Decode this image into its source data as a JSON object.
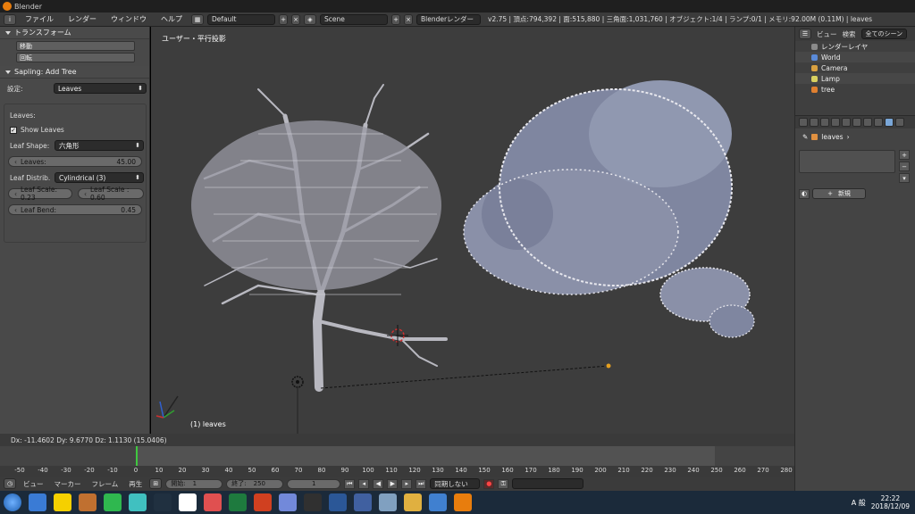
{
  "window": {
    "title": "Blender"
  },
  "menu": {
    "items": [
      "ファイル",
      "レンダー",
      "ウィンドウ",
      "ヘルプ"
    ],
    "layout": "Default",
    "scene": "Scene",
    "engine": "Blenderレンダー",
    "stats": "v2.75 | 頂点:794,392 | 面:515,880 | 三角面:1,031,760 | オブジェクト:1/4 | ランプ:0/1 | メモリ:92.00M (0.11M) | leaves"
  },
  "left_panel": {
    "transform_header": "トランスフォーム",
    "transform_buttons": [
      "移動",
      "回転"
    ],
    "sapling_header": "Sapling: Add Tree",
    "settings_label": "設定:",
    "settings_value": "Leaves",
    "leaves_title": "Leaves:",
    "show_leaves_label": "Show Leaves",
    "show_leaves_checked": true,
    "leaf_shape_label": "Leaf Shape:",
    "leaf_shape_value": "六角形",
    "leaves_field": {
      "label": "Leaves:",
      "value": "45.00"
    },
    "leaf_distrib_label": "Leaf Distrib.",
    "leaf_distrib_value": "Cylindrical (3)",
    "leaf_scale": {
      "label": "Leaf Scale: 0.23"
    },
    "leaf_scale_x": {
      "label": "Leaf Scale : 0.60"
    },
    "leaf_bend": {
      "label": "Leaf Bend:",
      "value": "0.45"
    }
  },
  "viewport": {
    "view_label": "ユーザー・平行投影",
    "object_label": "(1) leaves"
  },
  "info_strip": {
    "text": "Dx: -11.4602   Dy: 9.6770   Dz: 1.1130 (15.0406)"
  },
  "timeline": {
    "ticks": [
      "-50",
      "-40",
      "-30",
      "-20",
      "-10",
      "0",
      "10",
      "20",
      "30",
      "40",
      "50",
      "60",
      "70",
      "80",
      "90",
      "100",
      "110",
      "120",
      "130",
      "140",
      "150",
      "160",
      "170",
      "180",
      "190",
      "200",
      "210",
      "220",
      "230",
      "240",
      "250",
      "260",
      "270",
      "280"
    ],
    "current_frame": 0,
    "menu": [
      "ビュー",
      "マーカー",
      "フレーム",
      "再生"
    ],
    "start_label": "開始:",
    "start_value": "1",
    "end_label": "終了:",
    "end_value": "250",
    "frame_value": "1",
    "sync": "同期しない"
  },
  "right_panel": {
    "header_view": "ビュー",
    "header_search": "検索",
    "header_scenes": "全てのシーン",
    "outliner": [
      {
        "label": "レンダーレイヤ",
        "color": "#8a8a8a"
      },
      {
        "label": "World",
        "color": "#5a8ad8"
      },
      {
        "label": "Camera",
        "color": "#d8a040"
      },
      {
        "label": "Lamp",
        "color": "#d8d060"
      },
      {
        "label": "tree",
        "color": "#e08030"
      }
    ],
    "crumb": "leaves",
    "new_label": "新規"
  },
  "taskbar": {
    "time": "22:22",
    "date": "2018/12/09",
    "ime": "A 般",
    "icons": [
      {
        "name": "chrome-icon",
        "color": "#3a7bd5"
      },
      {
        "name": "talk-icon",
        "color": "#f5d000"
      },
      {
        "name": "app-icon",
        "color": "#c07030"
      },
      {
        "name": "line-icon",
        "color": "#2fb84f"
      },
      {
        "name": "miku-icon",
        "color": "#40c0c0"
      },
      {
        "name": "steam-icon",
        "color": "#203040"
      },
      {
        "name": "app2-icon",
        "color": "#ffffff"
      },
      {
        "name": "paint-icon",
        "color": "#e05050"
      },
      {
        "name": "excel-icon",
        "color": "#1e7a3e"
      },
      {
        "name": "powerpoint-icon",
        "color": "#d04020"
      },
      {
        "name": "discord-icon",
        "color": "#7289da"
      },
      {
        "name": "nox-icon",
        "color": "#303030"
      },
      {
        "name": "word-icon",
        "color": "#2b5797"
      },
      {
        "name": "lens-icon",
        "color": "#4060a0"
      },
      {
        "name": "window-icon",
        "color": "#80a0c0"
      },
      {
        "name": "folder-icon",
        "color": "#e0b040"
      },
      {
        "name": "krita-icon",
        "color": "#4080d0"
      },
      {
        "name": "blender-icon",
        "color": "#e87d0d"
      }
    ]
  }
}
